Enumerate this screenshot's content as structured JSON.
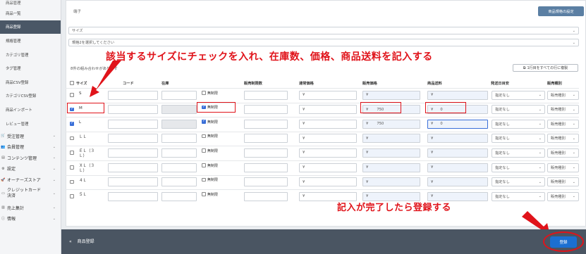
{
  "sidebar": {
    "top_label": "商品管理",
    "items": [
      {
        "label": "商品一覧",
        "active": false
      },
      {
        "label": "商品登録",
        "active": true
      },
      {
        "label": "規格管理",
        "active": false
      },
      {
        "label": "カテゴリ管理",
        "active": false
      },
      {
        "label": "タグ管理",
        "active": false
      },
      {
        "label": "商品CSV登録",
        "active": false
      },
      {
        "label": "カテゴリCSV登録",
        "active": false
      },
      {
        "label": "商品インポート",
        "active": false
      },
      {
        "label": "レビュー管理",
        "active": false
      }
    ],
    "sections": [
      {
        "label": "受注管理",
        "icon": "cart-icon"
      },
      {
        "label": "会員管理",
        "icon": "users-icon"
      },
      {
        "label": "コンテンツ管理",
        "icon": "document-icon"
      },
      {
        "label": "設定",
        "icon": "gear-icon"
      },
      {
        "label": "オーナーズストア",
        "icon": "rocket-icon"
      },
      {
        "label": "クレジットカード決済",
        "icon": "credit-card-icon"
      },
      {
        "label": "売上集計",
        "icon": "chart-icon"
      },
      {
        "label": "情報",
        "icon": "info-icon"
      }
    ]
  },
  "main": {
    "tag_label": "端子",
    "spec_button": "商品規格の設定",
    "spec1_select": "サイズ",
    "spec2_select": "規格2を選択してください",
    "count_text": "8件の組み合わせがあります",
    "copy_button": "1行目をすべての行に複製",
    "columns": {
      "size": "サイズ",
      "code": "コード",
      "stock": "在庫",
      "sale_limit": "販売制限数",
      "normal_price": "通常価格",
      "sale_price": "販売価格",
      "shipping": "商品送料",
      "ship_date": "発送日目安",
      "sale_type": "販売種別"
    },
    "currency": "¥",
    "unlimited_label": "無制限",
    "ship_date_default": "指定なし",
    "sale_type_default": "販売種別",
    "rows": [
      {
        "size": "S",
        "checked": false,
        "unlimited": false,
        "sale_price": "",
        "shipping": ""
      },
      {
        "size": "M",
        "checked": true,
        "unlimited": true,
        "sale_price": "750",
        "shipping": "0"
      },
      {
        "size": "L",
        "checked": true,
        "unlimited": true,
        "sale_price": "750",
        "shipping": "0"
      },
      {
        "size": "ＬＬ",
        "checked": false,
        "unlimited": false,
        "sale_price": "",
        "shipping": ""
      },
      {
        "size": "ＥＬ（３Ｌ）",
        "checked": false,
        "unlimited": false,
        "sale_price": "",
        "shipping": ""
      },
      {
        "size": "ＸＬ（３Ｌ）",
        "checked": false,
        "unlimited": false,
        "sale_price": "",
        "shipping": ""
      },
      {
        "size": "４Ｌ",
        "checked": false,
        "unlimited": false,
        "sale_price": "",
        "shipping": ""
      },
      {
        "size": "５Ｌ",
        "checked": false,
        "unlimited": false,
        "sale_price": "",
        "shipping": ""
      }
    ]
  },
  "annotations": {
    "top_callout": "該当するサイズにチェックを入れ、在庫数、価格、商品送料を記入する",
    "bottom_callout": "記入が完了したら登録する",
    "color": "#e0131a"
  },
  "footer": {
    "back_label": "商品登録",
    "register_button": "登録"
  }
}
